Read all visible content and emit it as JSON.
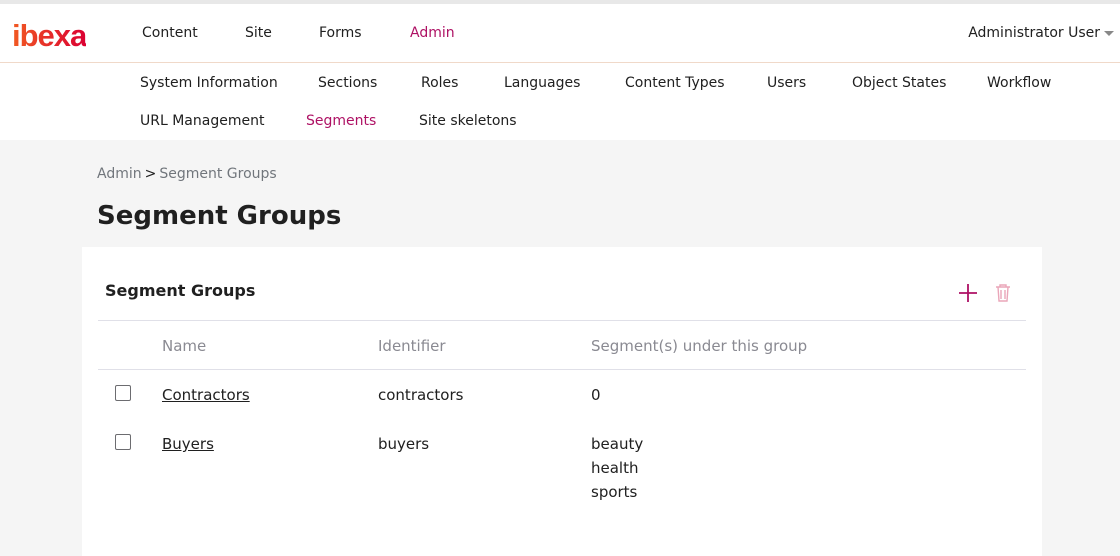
{
  "brand": {
    "logo_text": "ibexa",
    "accent": "#ae1164",
    "logo_gradient": [
      "#f15a22",
      "#db0032"
    ]
  },
  "main_nav": [
    {
      "label": "Content",
      "active": false
    },
    {
      "label": "Site",
      "active": false
    },
    {
      "label": "Forms",
      "active": false
    },
    {
      "label": "Admin",
      "active": true
    }
  ],
  "user_menu": {
    "label": "Administrator User"
  },
  "sub_nav": [
    {
      "label": "System Information",
      "active": false
    },
    {
      "label": "Sections",
      "active": false
    },
    {
      "label": "Roles",
      "active": false
    },
    {
      "label": "Languages",
      "active": false
    },
    {
      "label": "Content Types",
      "active": false
    },
    {
      "label": "Users",
      "active": false
    },
    {
      "label": "Object States",
      "active": false
    },
    {
      "label": "Workflow",
      "active": false
    },
    {
      "label": "URL Management",
      "active": false
    },
    {
      "label": "Segments",
      "active": true
    },
    {
      "label": "Site skeletons",
      "active": false
    }
  ],
  "breadcrumb": {
    "root": "Admin",
    "separator": ">",
    "current": "Segment Groups"
  },
  "page": {
    "title": "Segment Groups"
  },
  "card": {
    "title": "Segment Groups",
    "actions": {
      "add_icon": "plus-icon",
      "delete_icon": "trash-icon"
    },
    "columns": {
      "name": "Name",
      "identifier": "Identifier",
      "segments": "Segment(s) under this group"
    },
    "rows": [
      {
        "name": "Contractors",
        "identifier": "contractors",
        "segments": [
          "0"
        ],
        "checked": false
      },
      {
        "name": "Buyers",
        "identifier": "buyers",
        "segments": [
          "beauty",
          "health",
          "sports"
        ],
        "checked": false
      }
    ]
  }
}
